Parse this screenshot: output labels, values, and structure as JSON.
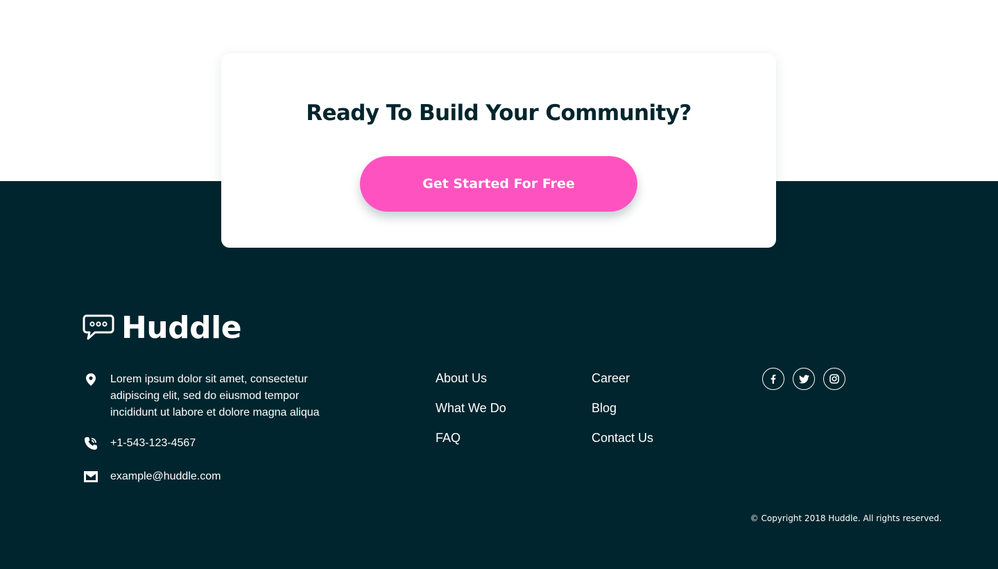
{
  "cta": {
    "title": "Ready To Build Your Community?",
    "button_label": "Get Started For Free"
  },
  "brand": {
    "name": "Huddle",
    "logo_icon": "speech-bubble-icon"
  },
  "contact": {
    "address": "Lorem ipsum dolor sit amet, consectetur adipiscing elit, sed do eiusmod tempor incididunt ut labore et dolore magna aliqua",
    "phone": "+1-543-123-4567",
    "email": "example@huddle.com"
  },
  "nav": {
    "column1": [
      "About Us",
      "What We Do",
      "FAQ"
    ],
    "column2": [
      "Career",
      "Blog",
      "Contact Us"
    ]
  },
  "socials": [
    "facebook-icon",
    "twitter-icon",
    "instagram-icon"
  ],
  "copyright": "© Copyright 2018 Huddle. All rights reserved.",
  "colors": {
    "dark_blue": "#00252e",
    "pink": "#ff52c1",
    "white": "#ffffff"
  }
}
